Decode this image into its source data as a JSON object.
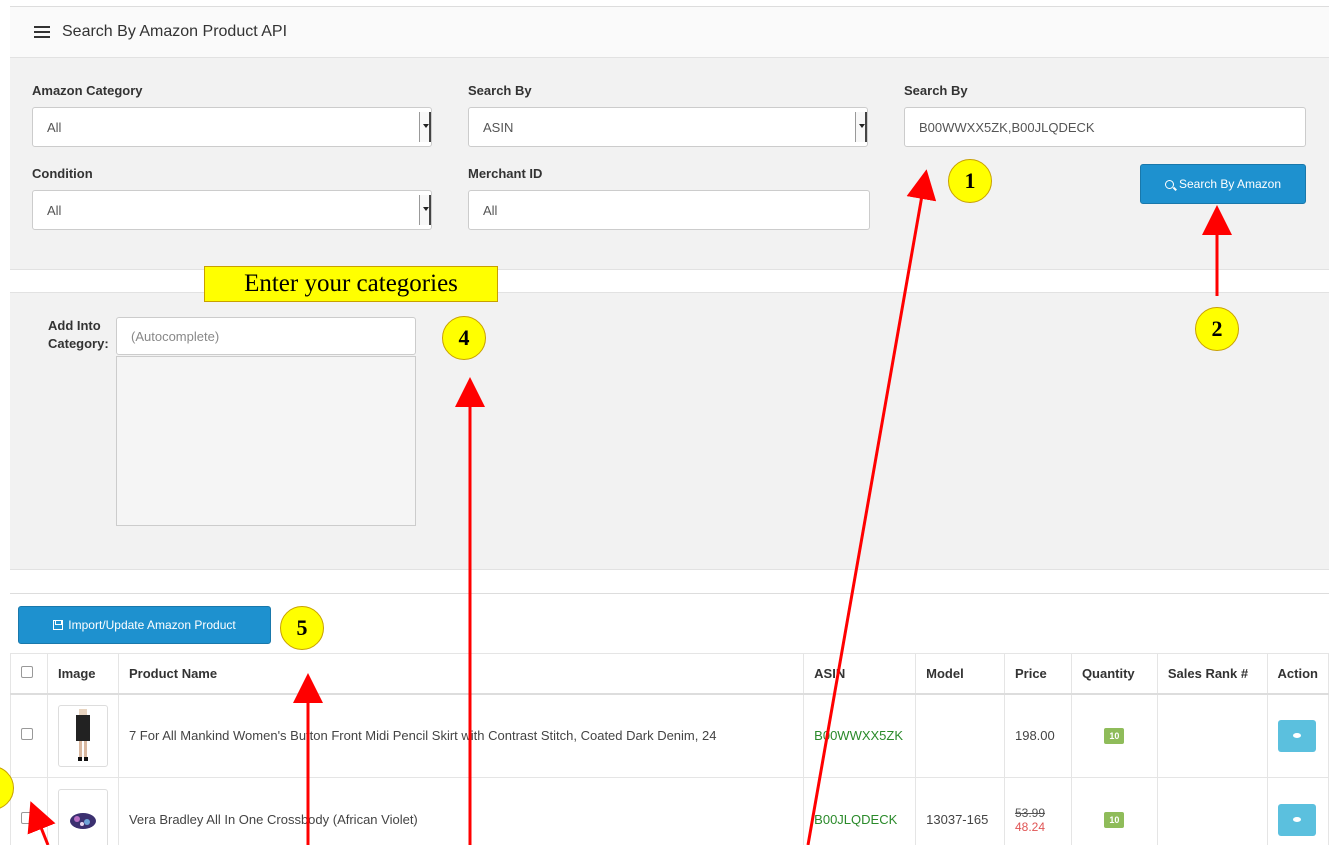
{
  "header": {
    "title": "Search By Amazon Product API",
    "icon": "list-icon"
  },
  "filters": {
    "amazon_category": {
      "label": "Amazon Category",
      "value": "All"
    },
    "search_by_type": {
      "label": "Search By",
      "value": "ASIN"
    },
    "search_by_value": {
      "label": "Search By",
      "value": "B00WWXX5ZK,B00JLQDECK"
    },
    "condition": {
      "label": "Condition",
      "value": "All"
    },
    "merchant_id": {
      "label": "Merchant ID",
      "value": "All"
    },
    "search_button": "Search By Amazon"
  },
  "category": {
    "label": "Add Into Category:",
    "placeholder": "(Autocomplete)"
  },
  "import_button": "Import/Update Amazon Product",
  "table": {
    "headers": [
      "Image",
      "Product Name",
      "ASIN",
      "Model",
      "Price",
      "Quantity",
      "Sales Rank #",
      "Action"
    ],
    "rows": [
      {
        "name": "7 For All Mankind Women's Button Front Midi Pencil Skirt with Contrast Stitch, Coated Dark Denim, 24",
        "asin": "B00WWXX5ZK",
        "model": "",
        "price": "198.00",
        "quantity": "10",
        "sales_rank": ""
      },
      {
        "name": "Vera Bradley All In One Crossbody (African Violet)",
        "asin": "B00JLQDECK",
        "model": "13037-165",
        "price_old": "53.99",
        "price": "48.24",
        "quantity": "10",
        "sales_rank": ""
      }
    ]
  },
  "annotations": {
    "callouts": [
      "1",
      "2",
      "4",
      "5"
    ],
    "note": "Enter your categories",
    "color": "#ff0000",
    "highlight": "#ffff00"
  },
  "colors": {
    "primary": "#1e91cf",
    "info": "#5bc0de",
    "asin": "#2a8a2a",
    "sale": "#e05555"
  }
}
